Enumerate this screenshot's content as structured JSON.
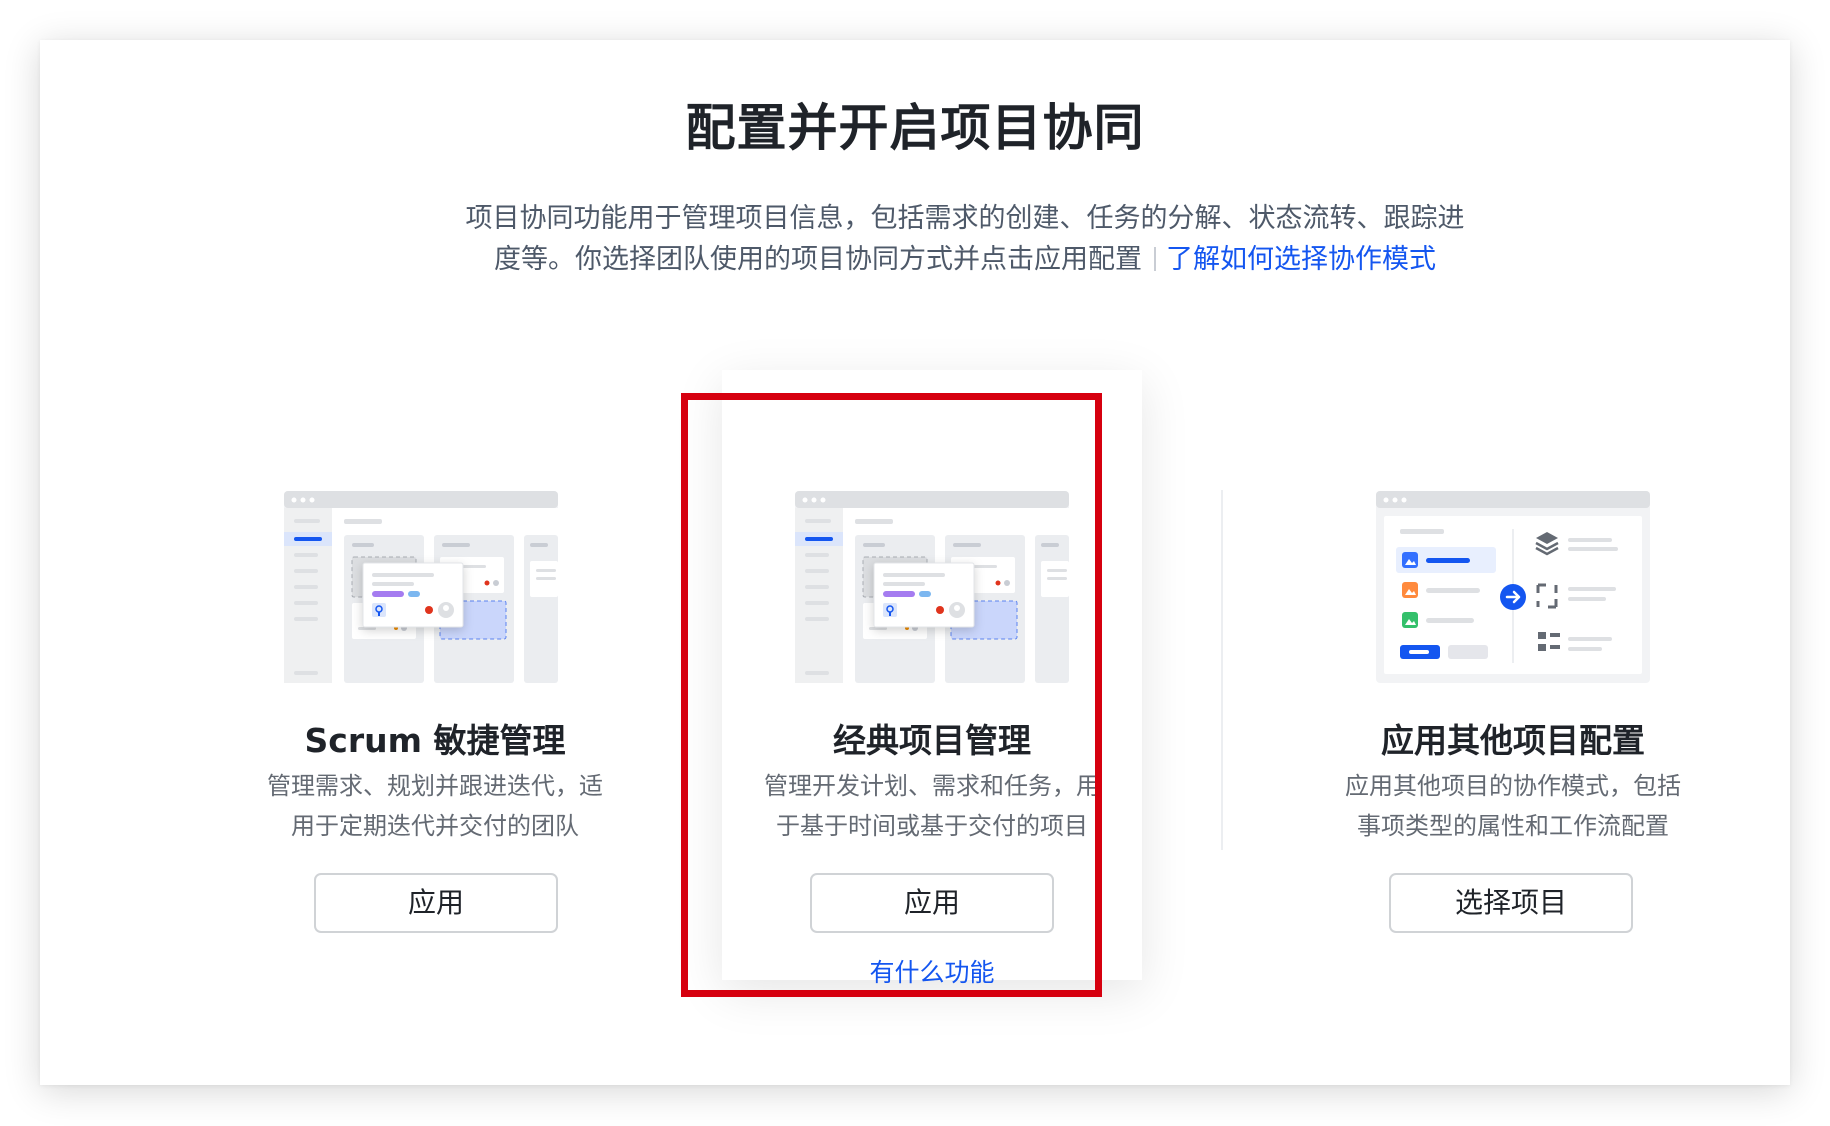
{
  "header": {
    "title": "配置并开启项目协同",
    "description_line1": "项目协同功能用于管理项目信息，包括需求的创建、任务的分解、状态流转、跟踪进",
    "description_line2": "度等。你选择团队使用的项目协同方式并点击应用配置",
    "learn_link": "了解如何选择协作模式"
  },
  "cards": [
    {
      "title": "Scrum 敏捷管理",
      "text_line1": "管理需求、规划并跟进迭代，适",
      "text_line2": "用于定期迭代并交付的团队",
      "button": "应用",
      "illustration": "kanban-board-illustration"
    },
    {
      "title": "经典项目管理",
      "text_line1": "管理开发计划、需求和任务，用",
      "text_line2": "于基于时间或基于交付的项目",
      "button": "应用",
      "link": "有什么功能",
      "illustration": "kanban-board-illustration",
      "highlighted": true
    },
    {
      "title": "应用其他项目配置",
      "text_line1": "应用其他项目的协作模式，包括",
      "text_line2": "事项类型的属性和工作流配置",
      "button": "选择项目",
      "illustration": "config-transfer-illustration"
    }
  ],
  "colors": {
    "accent": "#1456f0",
    "highlight_border": "#d6000f",
    "title": "#1f2329",
    "body_text": "#646a73"
  }
}
